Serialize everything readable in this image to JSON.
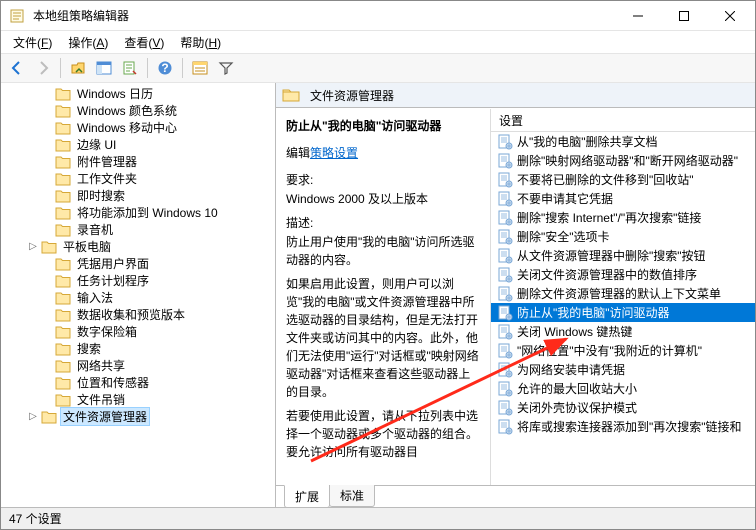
{
  "window": {
    "title": "本地组策略编辑器",
    "controls": {
      "minimize": "–",
      "maximize": "☐",
      "close": "✕"
    }
  },
  "menu": {
    "file": {
      "label": "文件",
      "hotkey": "F"
    },
    "action": {
      "label": "操作",
      "hotkey": "A"
    },
    "view": {
      "label": "查看",
      "hotkey": "V"
    },
    "help": {
      "label": "帮助",
      "hotkey": "H"
    }
  },
  "tree": {
    "items": [
      {
        "label": "Windows 日历",
        "expandable": false
      },
      {
        "label": "Windows 颜色系统",
        "expandable": false
      },
      {
        "label": "Windows 移动中心",
        "expandable": false
      },
      {
        "label": "边缘 UI",
        "expandable": false
      },
      {
        "label": "附件管理器",
        "expandable": false
      },
      {
        "label": "工作文件夹",
        "expandable": false
      },
      {
        "label": "即时搜索",
        "expandable": false
      },
      {
        "label": "将功能添加到 Windows 10",
        "expandable": false
      },
      {
        "label": "录音机",
        "expandable": false
      },
      {
        "label": "平板电脑",
        "expandable": true
      },
      {
        "label": "凭据用户界面",
        "expandable": false
      },
      {
        "label": "任务计划程序",
        "expandable": false
      },
      {
        "label": "输入法",
        "expandable": false
      },
      {
        "label": "数据收集和预览版本",
        "expandable": false
      },
      {
        "label": "数字保险箱",
        "expandable": false
      },
      {
        "label": "搜索",
        "expandable": false
      },
      {
        "label": "网络共享",
        "expandable": false
      },
      {
        "label": "位置和传感器",
        "expandable": false
      },
      {
        "label": "文件吊销",
        "expandable": false
      },
      {
        "label": "文件资源管理器",
        "expandable": true,
        "selected": true
      }
    ]
  },
  "right": {
    "header": "文件资源管理器",
    "desc": {
      "title": "防止从\"我的电脑\"访问驱动器",
      "edit_prefix": "编辑",
      "edit_link": "策略设置",
      "req_label": "要求:",
      "req_text": "Windows 2000 及以上版本",
      "desc_label": "描述:",
      "desc_p1": "防止用户使用\"我的电脑\"访问所选驱动器的内容。",
      "desc_p2": "如果启用此设置，则用户可以浏览\"我的电脑\"或文件资源管理器中所选驱动器的目录结构，但是无法打开文件夹或访问其中的内容。此外，他们无法使用\"运行\"对话框或\"映射网络驱动器\"对话框来查看这些驱动器上的目录。",
      "desc_p3": "若要使用此设置，请从下拉列表中选择一个驱动器或多个驱动器的组合。要允许访问所有驱动器目"
    },
    "list": {
      "header": "设置",
      "items": [
        {
          "label": "从\"我的电脑\"删除共享文档"
        },
        {
          "label": "删除\"映射网络驱动器\"和\"断开网络驱动器\""
        },
        {
          "label": "不要将已删除的文件移到\"回收站\""
        },
        {
          "label": "不要申请其它凭据"
        },
        {
          "label": "删除\"搜索 Internet\"/\"再次搜索\"链接"
        },
        {
          "label": "删除\"安全\"选项卡"
        },
        {
          "label": "从文件资源管理器中删除\"搜索\"按钮"
        },
        {
          "label": "关闭文件资源管理器中的数值排序"
        },
        {
          "label": "删除文件资源管理器的默认上下文菜单"
        },
        {
          "label": "防止从\"我的电脑\"访问驱动器",
          "selected": true
        },
        {
          "label": "关闭 Windows 键热键"
        },
        {
          "label": "\"网络位置\"中没有\"我附近的计算机\""
        },
        {
          "label": "为网络安装申请凭据"
        },
        {
          "label": "允许的最大回收站大小"
        },
        {
          "label": "关闭外壳协议保护模式"
        },
        {
          "label": "将库或搜索连接器添加到\"再次搜索\"链接和"
        }
      ]
    },
    "tabs": {
      "extended": "扩展",
      "standard": "标准"
    }
  },
  "status": {
    "text": "47 个设置"
  }
}
